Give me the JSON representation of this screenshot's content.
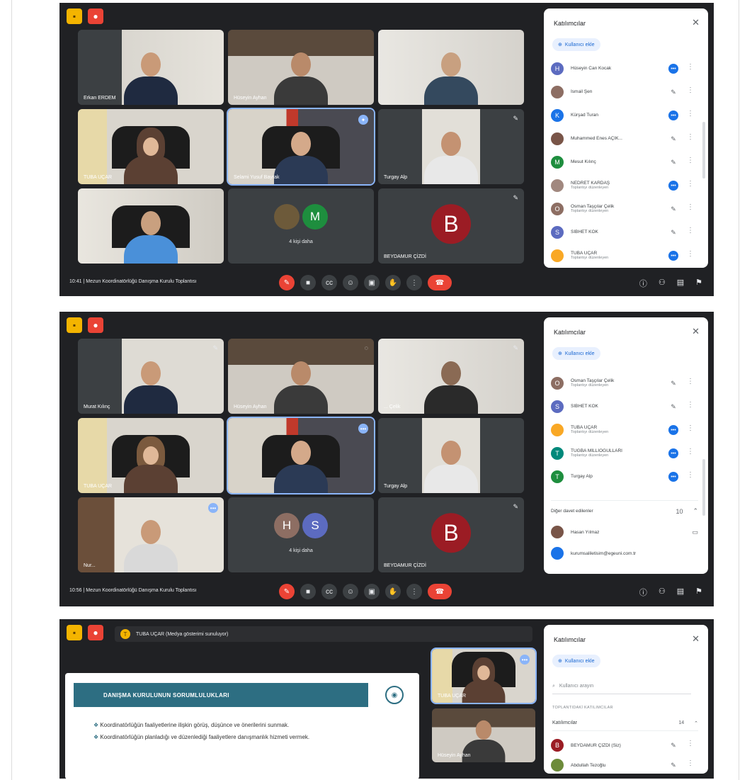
{
  "common": {
    "panel_title": "Katılımcılar",
    "add_people": "Kullanıcı ekle",
    "close": "✕",
    "icon_folder": "folder-icon",
    "icon_record": "record-icon"
  },
  "shot1": {
    "tiles": [
      {
        "name": "Erkan ERDEM"
      },
      {
        "name": "Hüseyin Ayhan"
      },
      {
        "name": ""
      },
      {
        "name": "TUBA UÇAR"
      },
      {
        "name": "Selami Yusuf Bayrak"
      },
      {
        "name": "Turgay Alp"
      },
      {
        "name": ""
      },
      {
        "name": "",
        "others": "4 kişi daha",
        "a1": "",
        "a2": "M"
      },
      {
        "name": "BEYDAMUR ÇİZDİ",
        "avatar": "B"
      }
    ],
    "participants": [
      {
        "initial": "H",
        "name": "Hüseyin Can Kocak",
        "sub": ""
      },
      {
        "initial": "",
        "name": "İsmail Şen",
        "sub": ""
      },
      {
        "initial": "K",
        "name": "Kürşad Turan",
        "sub": ""
      },
      {
        "initial": "",
        "name": "Muhammed Enes AÇIK...",
        "sub": ""
      },
      {
        "initial": "M",
        "name": "Mesut Kılınç",
        "sub": ""
      },
      {
        "initial": "",
        "name": "NEDRET KARDAŞ",
        "sub": "Toplantıyı düzenleyen"
      },
      {
        "initial": "O",
        "name": "Osman Taşçılar Çelik",
        "sub": "Toplantıyı düzenleyen"
      },
      {
        "initial": "S",
        "name": "SİBHET KOK",
        "sub": ""
      },
      {
        "initial": "",
        "name": "TUBA UÇAR",
        "sub": "Toplantıyı düzenleyen"
      }
    ],
    "time": "10:41",
    "meeting_title": "Mezun Koordinatörlüğü Danışma Kurulu Toplantısı"
  },
  "shot2": {
    "tiles": [
      {
        "name": "Murat Kılınç"
      },
      {
        "name": "Hüseyin Ayhan"
      },
      {
        "name": "... Çelik"
      },
      {
        "name": "TUBA UÇAR"
      },
      {
        "name": ""
      },
      {
        "name": "Turgay Alp"
      },
      {
        "name": "Nur..."
      },
      {
        "name": "",
        "others": "4 kişi daha",
        "a1": "H",
        "a2": "S"
      },
      {
        "name": "BEYDAMUR ÇİZDİ",
        "avatar": "B"
      }
    ],
    "participants": [
      {
        "initial": "O",
        "name": "Osman Taşçılar Çelik",
        "sub": "Toplantıyı düzenleyen"
      },
      {
        "initial": "S",
        "name": "SİBHET KOK",
        "sub": ""
      },
      {
        "initial": "",
        "name": "TUBA UÇAR",
        "sub": "Toplantıyı düzenleyen"
      },
      {
        "initial": "T",
        "name": "TUĞBA MİLLİOĞULLARI",
        "sub": "Toplantıyı düzenleyen"
      },
      {
        "initial": "T",
        "name": "Turgay Alp",
        "sub": ""
      }
    ],
    "extra_section_label": "Diğer davet edilenler",
    "extra_count": "10",
    "extra_people": [
      {
        "name": "Hasan Yılmaz"
      },
      {
        "name": "kurumsaliletisim@egeuni.com.tr"
      }
    ],
    "time": "10:56",
    "meeting_title": "Mezun Koordinatörlüğü Danışma Kurulu Toplantısı"
  },
  "shot3": {
    "banner": "TUBA UÇAR (Medya gösterimi sunuluyor)",
    "slide_title": "DANIŞMA KURULUNUN SORUMLULUKLARI",
    "slide_points": [
      "Koordinatörlüğün faaliyetlerine ilişkin görüş, düşünce ve önerilerini sunmak.",
      "Koordinatörlüğün planladığı ve düzenlediği faaliyetlere danışmanlık hizmeti vermek."
    ],
    "selfview1_name": "TUBA UÇAR",
    "selfview2_name": "Hüseyin Ayhan",
    "search_placeholder": "Kullanıcı arayın",
    "list_label": "TOPLANTIDAKİ KATILIMCILAR",
    "group_label": "Katılımcılar",
    "group_count": "14",
    "participants": [
      {
        "initial": "B",
        "name": "BEYDAMUR ÇİZDİ (Siz)",
        "sub": ""
      },
      {
        "initial": "",
        "name": "Abdullah Tezoğlu",
        "sub": ""
      }
    ]
  },
  "colors": {
    "meet_bg": "#202124",
    "tile_bg": "#3c4043",
    "accent": "#1a73e8",
    "danger": "#ea4335",
    "slide_header": "#2d6e82",
    "avatar_b": "#9b1c24"
  }
}
